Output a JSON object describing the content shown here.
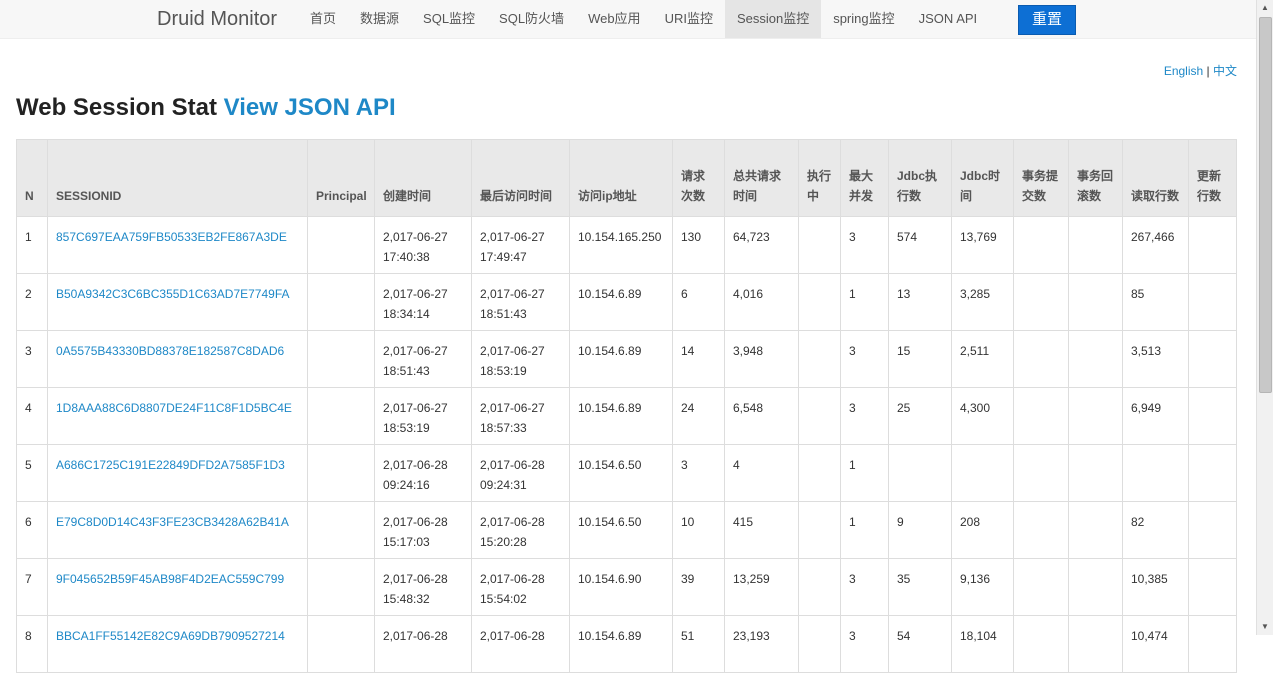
{
  "navbar": {
    "brand": "Druid Monitor",
    "items": [
      {
        "label": "首页"
      },
      {
        "label": "数据源"
      },
      {
        "label": "SQL监控"
      },
      {
        "label": "SQL防火墙"
      },
      {
        "label": "Web应用"
      },
      {
        "label": "URI监控"
      },
      {
        "label": "Session监控",
        "active": true
      },
      {
        "label": "spring监控"
      },
      {
        "label": "JSON API"
      }
    ],
    "reset_label": "重置"
  },
  "lang": {
    "english": "English",
    "sep": "|",
    "chinese": "中文"
  },
  "heading": {
    "title": "Web Session Stat",
    "api_link": "View JSON API"
  },
  "table": {
    "columns": [
      "N",
      "SESSIONID",
      "Principal",
      "创建时间",
      "最后访问时间",
      "访问ip地址",
      "请求次数",
      "总共请求时间",
      "执行中",
      "最大并发",
      "Jdbc执行数",
      "Jdbc时间",
      "事务提交数",
      "事务回滚数",
      "读取行数",
      "更新行数"
    ],
    "rows": [
      {
        "n": "1",
        "id": "857C697EAA759FB50533EB2FE867A3DE",
        "principal": "",
        "created_d": "2,017-06-27",
        "created_t": "17:40:38",
        "last_d": "2,017-06-27",
        "last_t": "17:49:47",
        "ip": "10.154.165.250",
        "req": "130",
        "total": "64,723",
        "running": "",
        "maxc": "3",
        "jdbc_exec": "574",
        "jdbc_time": "13,769",
        "tx_commit": "",
        "tx_rollback": "",
        "read_rows": "267,466",
        "update_rows": ""
      },
      {
        "n": "2",
        "id": "B50A9342C3C6BC355D1C63AD7E7749FA",
        "principal": "",
        "created_d": "2,017-06-27",
        "created_t": "18:34:14",
        "last_d": "2,017-06-27",
        "last_t": "18:51:43",
        "ip": "10.154.6.89",
        "req": "6",
        "total": "4,016",
        "running": "",
        "maxc": "1",
        "jdbc_exec": "13",
        "jdbc_time": "3,285",
        "tx_commit": "",
        "tx_rollback": "",
        "read_rows": "85",
        "update_rows": ""
      },
      {
        "n": "3",
        "id": "0A5575B43330BD88378E182587C8DAD6",
        "principal": "",
        "created_d": "2,017-06-27",
        "created_t": "18:51:43",
        "last_d": "2,017-06-27",
        "last_t": "18:53:19",
        "ip": "10.154.6.89",
        "req": "14",
        "total": "3,948",
        "running": "",
        "maxc": "3",
        "jdbc_exec": "15",
        "jdbc_time": "2,511",
        "tx_commit": "",
        "tx_rollback": "",
        "read_rows": "3,513",
        "update_rows": ""
      },
      {
        "n": "4",
        "id": "1D8AAA88C6D8807DE24F11C8F1D5BC4E",
        "principal": "",
        "created_d": "2,017-06-27",
        "created_t": "18:53:19",
        "last_d": "2,017-06-27",
        "last_t": "18:57:33",
        "ip": "10.154.6.89",
        "req": "24",
        "total": "6,548",
        "running": "",
        "maxc": "3",
        "jdbc_exec": "25",
        "jdbc_time": "4,300",
        "tx_commit": "",
        "tx_rollback": "",
        "read_rows": "6,949",
        "update_rows": ""
      },
      {
        "n": "5",
        "id": "A686C1725C191E22849DFD2A7585F1D3",
        "principal": "",
        "created_d": "2,017-06-28",
        "created_t": "09:24:16",
        "last_d": "2,017-06-28",
        "last_t": "09:24:31",
        "ip": "10.154.6.50",
        "req": "3",
        "total": "4",
        "running": "",
        "maxc": "1",
        "jdbc_exec": "",
        "jdbc_time": "",
        "tx_commit": "",
        "tx_rollback": "",
        "read_rows": "",
        "update_rows": ""
      },
      {
        "n": "6",
        "id": "E79C8D0D14C43F3FE23CB3428A62B41A",
        "principal": "",
        "created_d": "2,017-06-28",
        "created_t": "15:17:03",
        "last_d": "2,017-06-28",
        "last_t": "15:20:28",
        "ip": "10.154.6.50",
        "req": "10",
        "total": "415",
        "running": "",
        "maxc": "1",
        "jdbc_exec": "9",
        "jdbc_time": "208",
        "tx_commit": "",
        "tx_rollback": "",
        "read_rows": "82",
        "update_rows": ""
      },
      {
        "n": "7",
        "id": "9F045652B59F45AB98F4D2EAC559C799",
        "principal": "",
        "created_d": "2,017-06-28",
        "created_t": "15:48:32",
        "last_d": "2,017-06-28",
        "last_t": "15:54:02",
        "ip": "10.154.6.90",
        "req": "39",
        "total": "13,259",
        "running": "",
        "maxc": "3",
        "jdbc_exec": "35",
        "jdbc_time": "9,136",
        "tx_commit": "",
        "tx_rollback": "",
        "read_rows": "10,385",
        "update_rows": ""
      },
      {
        "n": "8",
        "id": "BBCA1FF55142E82C9A69DB7909527214",
        "principal": "",
        "created_d": "2,017-06-28",
        "created_t": "",
        "last_d": "2,017-06-28",
        "last_t": "",
        "ip": "10.154.6.89",
        "req": "51",
        "total": "23,193",
        "running": "",
        "maxc": "3",
        "jdbc_exec": "54",
        "jdbc_time": "18,104",
        "tx_commit": "",
        "tx_rollback": "",
        "read_rows": "10,474",
        "update_rows": ""
      }
    ]
  },
  "icons": {
    "scroll_up": "arrow-up-icon",
    "scroll_down": "arrow-down-icon"
  }
}
